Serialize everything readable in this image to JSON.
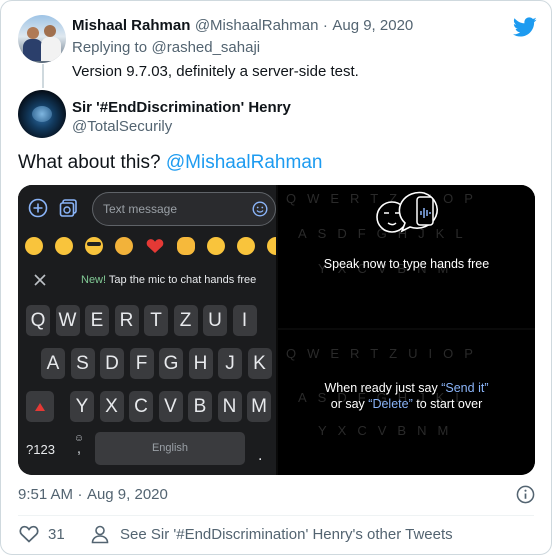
{
  "parent": {
    "name": "Mishaal Rahman",
    "handle": "@MishaalRahman",
    "dot": "·",
    "date": "Aug 9, 2020",
    "replying_prefix": "Replying to",
    "replying_to": "@rashed_sahaji",
    "text": "Version 9.7.03, definitely a server-side test."
  },
  "tweet": {
    "name": "Sir '#EndDiscrimination' Henry",
    "handle": "@TotalSecurily",
    "text_prefix": "What about this?",
    "text_mention": "@MishaalRahman",
    "time": "9:51 AM",
    "dot": "·",
    "date": "Aug 9, 2020",
    "likes": "31",
    "other_tweets": "See Sir '#EndDiscrimination' Henry's other Tweets"
  },
  "media": {
    "keyboard": {
      "input_placeholder": "Text message",
      "new_label": "New!",
      "hint": "Tap the mic to chat hands free",
      "row1": [
        "Q",
        "W",
        "E",
        "R",
        "T",
        "Z",
        "U",
        "I"
      ],
      "row2": [
        "A",
        "S",
        "D",
        "F",
        "G",
        "H",
        "J",
        "K"
      ],
      "row3": [
        "Y",
        "X",
        "C",
        "V",
        "B",
        "N",
        "M"
      ],
      "sym_key": "?123",
      "comma": ",",
      "space_label": "English",
      "period": "."
    },
    "panel_top": {
      "caption": "Speak now to type hands free"
    },
    "panel_bottom": {
      "line1_prefix": "When ready just say",
      "line1_cmd": "“Send it”",
      "line2_prefix": "or say",
      "line2_cmd": "“Delete”",
      "line2_suffix": "to start over"
    }
  },
  "colors": {
    "accent": "#1d9bf0",
    "green": "#81c995",
    "keyboard_bg": "#1b1c1e"
  }
}
